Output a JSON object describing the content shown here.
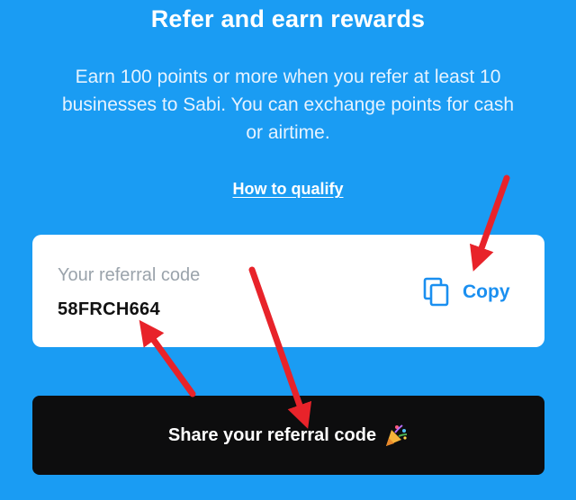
{
  "header": {
    "title": "Refer and earn rewards"
  },
  "intro": {
    "lines": [
      "Earn 100 points or more when you refer at least 10",
      "businesses to Sabi. You can exchange points for cash",
      "or airtime."
    ]
  },
  "qualify_link": {
    "label": "How to qualify"
  },
  "referral": {
    "label": "Your referral code",
    "code": "58FRCH664",
    "copy_label": "Copy",
    "copy_icon": "copy-icon"
  },
  "share_button": {
    "label": "Share your referral code",
    "icon": "party-popper-icon"
  },
  "colors": {
    "background": "#1a9cf3",
    "card": "#ffffff",
    "accent": "#1a8ff0",
    "share_button": "#0d0d0e",
    "annotation_arrow": "#e8232a"
  }
}
